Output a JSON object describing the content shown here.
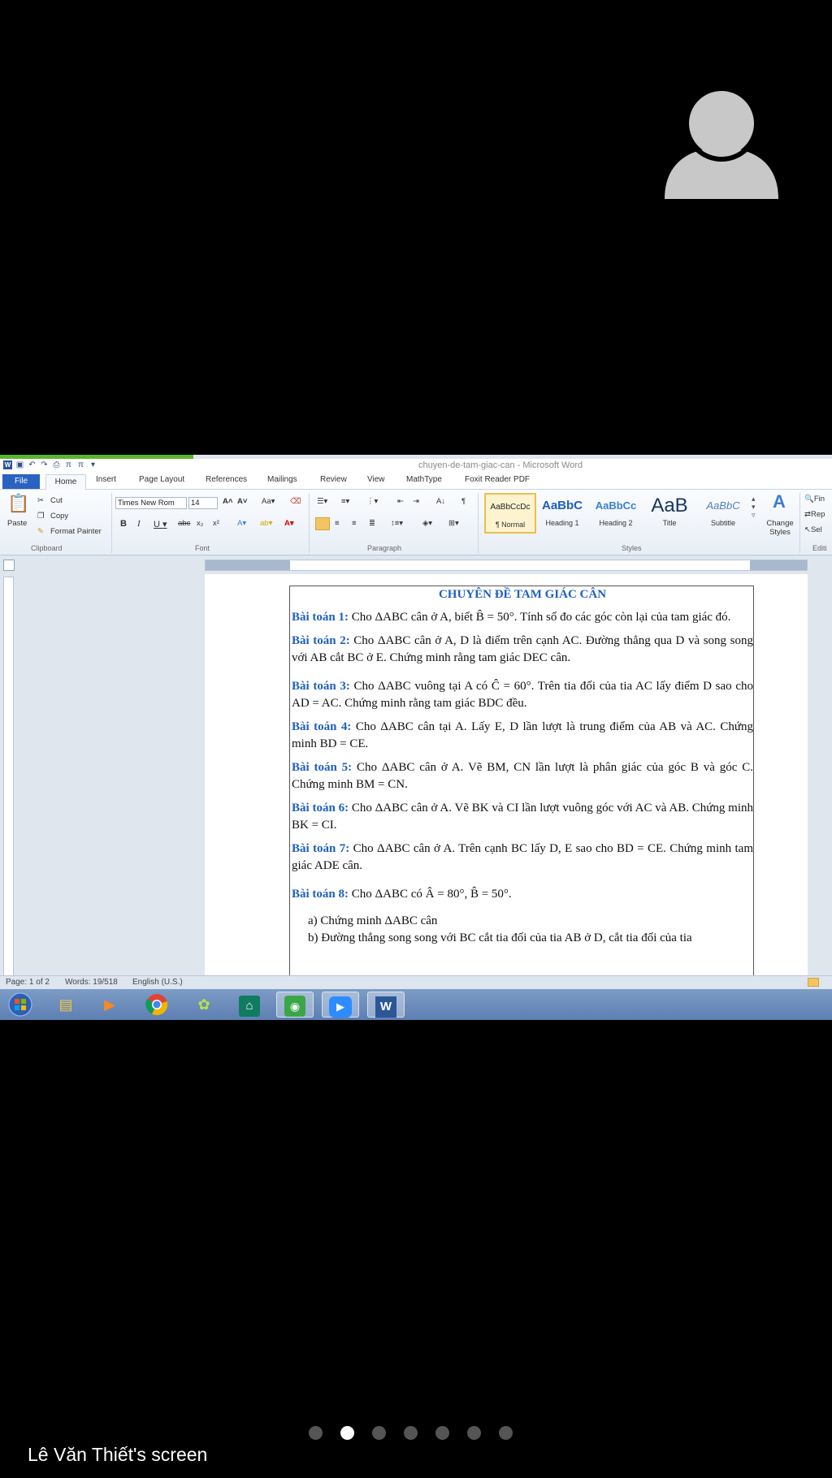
{
  "window": {
    "title": "chuyen-de-tam-giac-can - Microsoft Word"
  },
  "tabs": [
    "File",
    "Home",
    "Insert",
    "Page Layout",
    "References",
    "Mailings",
    "Review",
    "View",
    "MathType",
    "Foxit Reader PDF"
  ],
  "clipboard": {
    "paste": "Paste",
    "cut": "Cut",
    "copy": "Copy",
    "format_painter": "Format Painter",
    "label": "Clipboard"
  },
  "font": {
    "name": "Times New Rom",
    "size": "14",
    "label": "Font"
  },
  "paragraph": {
    "label": "Paragraph"
  },
  "styles": {
    "label": "Styles",
    "items": [
      {
        "sample": "AaBbCcDc",
        "name": "¶ Normal"
      },
      {
        "sample": "AaBbC",
        "name": "Heading 1"
      },
      {
        "sample": "AaBbCc",
        "name": "Heading 2"
      },
      {
        "sample": "AaB",
        "name": "Title"
      },
      {
        "sample": "AaBbC",
        "name": "Subtitle"
      }
    ],
    "change": "Change Styles"
  },
  "editing": {
    "find": "Fin",
    "replace": "Rep",
    "select": "Sel",
    "label": "Editi"
  },
  "document": {
    "heading": "CHUYÊN ĐỀ TAM GIÁC CÂN",
    "problems": [
      {
        "label": "Bài toán 1:",
        "text": " Cho ΔABC  cân ở A, biết B̂ = 50°.  Tính số đo các góc còn lại của tam giác đó."
      },
      {
        "label": "Bài toán 2:",
        "text": " Cho ΔABC  cân ở A, D là điểm trên cạnh AC. Đường thẳng qua D và song song với AB cắt BC ở E. Chứng minh rằng tam giác DEC cân."
      },
      {
        "label": "Bài toán 3:",
        "text": " Cho ΔABC  vuông tại A có Ĉ = 60°.  Trên tia đối của tia AC lấy điểm D sao cho AD = AC.  Chứng minh rằng tam giác BDC đều."
      },
      {
        "label": "Bài toán 4:",
        "text": " Cho ΔABC  cân tại A. Lấy E, D lần lượt là trung điểm của AB và AC. Chứng minh BD = CE."
      },
      {
        "label": "Bài toán 5:",
        "text": " Cho ΔABC  cân ở A. Vẽ BM, CN lần lượt là phân giác của góc B và góc C. Chứng minh BM = CN."
      },
      {
        "label": "Bài toán 6:",
        "text": " Cho ΔABC  cân ở A. Vẽ BK và CI lần lượt vuông góc với AC và AB. Chứng minh BK = CI."
      },
      {
        "label": "Bài toán 7:",
        "text": " Cho ΔABC  cân ở A. Trên cạnh BC lấy D, E sao cho BD = CE.  Chứng minh tam giác ADE cân."
      },
      {
        "label": "Bài toán 8:",
        "text": " Cho ΔABC  có Â = 80°,  B̂ = 50°."
      }
    ],
    "sub_a": "a)  Chứng minh ΔABC  cân",
    "sub_b": "b)  Đường thẳng song song với BC cắt tia đối của tia AB ở D, cắt tia đối của tia"
  },
  "status": {
    "page": "Page: 1 of 2",
    "words": "Words: 19/518",
    "language": "English (U.S.)"
  },
  "taskbar": [
    "start",
    "explorer",
    "media-player",
    "chrome",
    "app-green",
    "app-teal",
    "app-capture",
    "zoom",
    "word"
  ],
  "pager": {
    "count": 7,
    "active": 1
  },
  "share_label": "Lê Văn Thiết's screen"
}
